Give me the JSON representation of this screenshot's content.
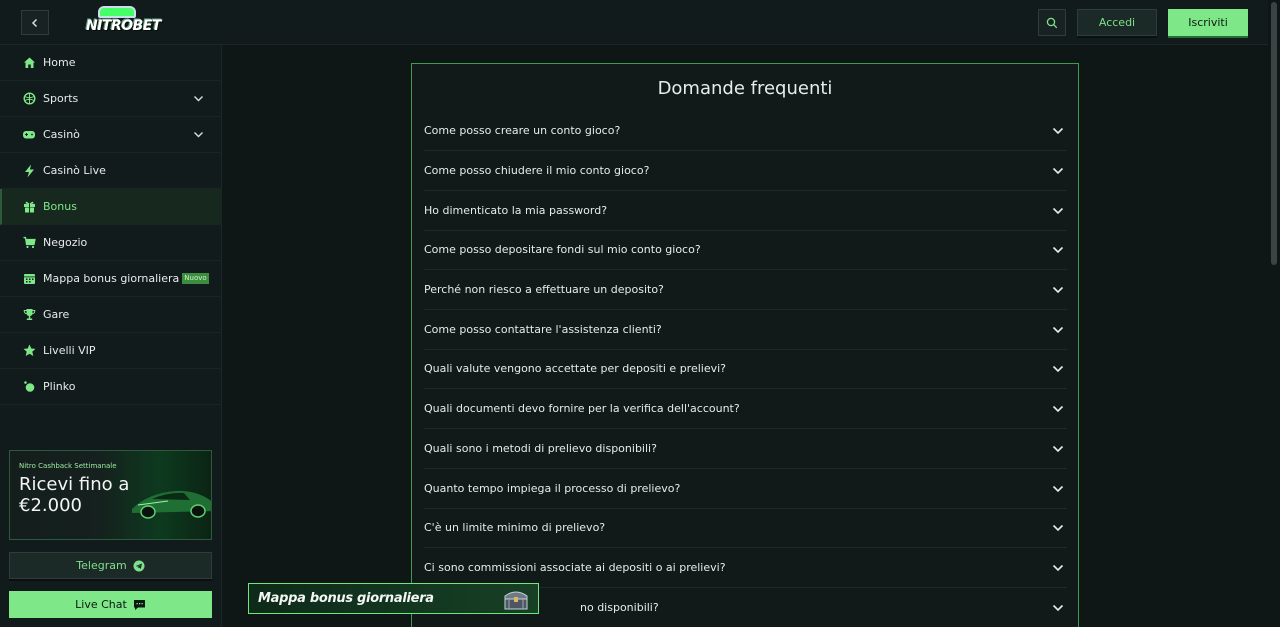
{
  "header": {
    "logo_text": "NITROBET",
    "login_label": "Accedi",
    "signup_label": "Iscriviti"
  },
  "sidebar": {
    "items": [
      {
        "label": "Home",
        "icon": "home-icon"
      },
      {
        "label": "Sports",
        "icon": "ball-icon",
        "expandable": true
      },
      {
        "label": "Casinò",
        "icon": "gamepad-icon",
        "expandable": true
      },
      {
        "label": "Casinò Live",
        "icon": "lightning-icon"
      },
      {
        "label": "Bonus",
        "icon": "gift-icon",
        "active": true
      },
      {
        "label": "Negozio",
        "icon": "cart-icon"
      },
      {
        "label": "Mappa bonus giornaliera",
        "icon": "calendar-icon",
        "badge": "Nuovo"
      },
      {
        "label": "Gare",
        "icon": "trophy-icon"
      },
      {
        "label": "Livelli VIP",
        "icon": "star-icon"
      },
      {
        "label": "Plinko",
        "icon": "plinko-icon"
      }
    ],
    "promo": {
      "tag": "Nitro Cashback Settimanale",
      "title": "Ricevi fino a €2.000"
    },
    "telegram_label": "Telegram",
    "live_chat_label": "Live Chat"
  },
  "faq": {
    "title": "Domande frequenti",
    "questions": [
      "Come posso creare un conto gioco?",
      "Come posso chiudere il mio conto gioco?",
      "Ho dimenticato la mia password?",
      "Come posso depositare fondi sul mio conto gioco?",
      "Perché non riesco a effettuare un deposito?",
      "Come posso contattare l'assistenza clienti?",
      "Quali valute vengono accettate per depositi e prelievi?",
      "Quali documenti devo fornire per la verifica dell'account?",
      "Quali sono i metodi di prelievo disponibili?",
      "Quanto tempo impiega il processo di prelievo?",
      "C'è un limite minimo di prelievo?",
      "Ci sono commissioni associate ai depositi o ai prelievi?",
      "no disponibili?"
    ]
  },
  "floating_banner": {
    "label": "Mappa bonus giornaliera"
  },
  "colors": {
    "accent": "#7ee787",
    "panel_border": "#3f9a52",
    "background": "#0f1616"
  }
}
